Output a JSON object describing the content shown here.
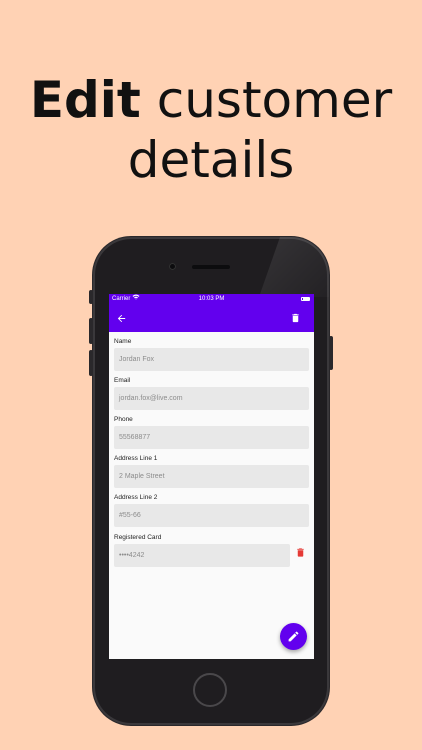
{
  "promo": {
    "title_bold": "Edit",
    "title_rest": "customer",
    "title_line2": "details"
  },
  "status_bar": {
    "carrier": "Carrier",
    "time": "10:03 PM"
  },
  "app_bar": {
    "back_icon": "arrow-back-icon",
    "delete_icon": "trash-icon",
    "color": "#6200ee"
  },
  "form": {
    "name": {
      "label": "Name",
      "value": "Jordan Fox"
    },
    "email": {
      "label": "Email",
      "value": "jordan.fox@live.com"
    },
    "phone": {
      "label": "Phone",
      "value": "55568877"
    },
    "address1": {
      "label": "Address Line 1",
      "value": "2 Maple Street"
    },
    "address2": {
      "label": "Address Line 2",
      "value": "#55-66"
    },
    "card": {
      "label": "Registered Card",
      "value": "••••4242",
      "delete_icon": "trash-icon",
      "delete_color": "#e53935"
    }
  },
  "fab": {
    "icon": "pencil-icon",
    "color": "#6200ee"
  }
}
